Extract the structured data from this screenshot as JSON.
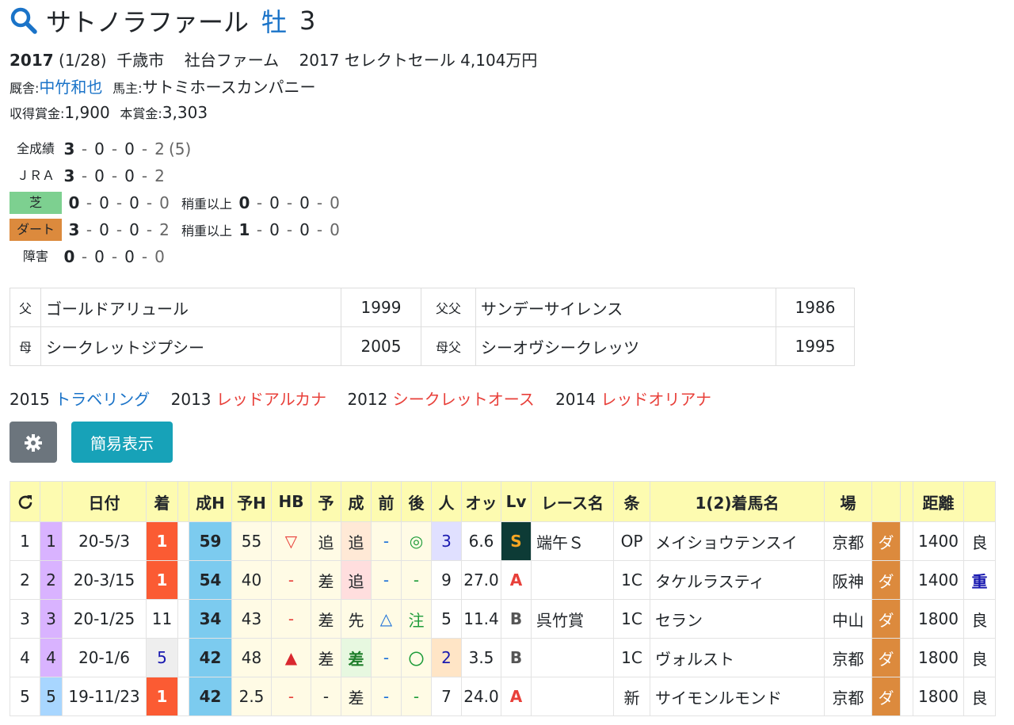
{
  "horse": {
    "name": "サトノラファール",
    "sex": "牡",
    "age": "3",
    "birth_year": "2017",
    "birth_date": "(1/28)",
    "birthplace": "千歳市",
    "breeder": "社台ファーム",
    "sale": "2017 セレクトセール 4,104万円",
    "stable_label": "厩舎:",
    "trainer": "中竹和也",
    "owner_label": "馬主:",
    "owner": "サトミホースカンパニー",
    "earned_label": "収得賞金:",
    "earned": "1,900",
    "prize_label": "本賞金:",
    "prize": "3,303"
  },
  "records": {
    "total": {
      "label": "全成績",
      "w": "3",
      "s": "0",
      "t": "0",
      "o": "2",
      "extra": "(5)"
    },
    "jra": {
      "label": "ＪＲＡ",
      "w": "3",
      "s": "0",
      "t": "0",
      "o": "2"
    },
    "turf": {
      "label": "芝",
      "w": "0",
      "s": "0",
      "t": "0",
      "o": "0",
      "heavy_label": "稍重以上",
      "hw": "0",
      "hs": "0",
      "ht": "0",
      "ho": "0"
    },
    "dirt": {
      "label": "ダート",
      "w": "3",
      "s": "0",
      "t": "0",
      "o": "2",
      "heavy_label": "稍重以上",
      "hw": "1",
      "hs": "0",
      "ht": "0",
      "ho": "0"
    },
    "obstacle": {
      "label": "障害",
      "w": "0",
      "s": "0",
      "t": "0",
      "o": "0"
    },
    "sep": "-"
  },
  "pedigree": {
    "sire_label": "父",
    "sire": "ゴールドアリュール",
    "sire_year": "1999",
    "sire_sire_label": "父父",
    "sire_sire": "サンデーサイレンス",
    "sire_sire_year": "1986",
    "dam_label": "母",
    "dam": "シークレットジプシー",
    "dam_year": "2005",
    "dam_sire_label": "母父",
    "dam_sire": "シーオヴシークレッツ",
    "dam_sire_year": "1995"
  },
  "siblings": [
    {
      "year": "2015",
      "name": "トラベリング",
      "color": "#1a73c8"
    },
    {
      "year": "2013",
      "name": "レッドアルカナ",
      "color": "#e8403a"
    },
    {
      "year": "2012",
      "name": "シークレットオース",
      "color": "#e8403a"
    },
    {
      "year": "2014",
      "name": "レッドオリアナ",
      "color": "#e8403a"
    }
  ],
  "buttons": {
    "gear_icon": "gear-icon",
    "simple_view": "簡易表示"
  },
  "table": {
    "headers": [
      "",
      "",
      "日付",
      "着",
      "",
      "成H",
      "予H",
      "HB",
      "予",
      "成",
      "前",
      "後",
      "人",
      "オッ",
      "Lv",
      "レース名",
      "条",
      "1(2)着馬名",
      "場",
      "",
      "",
      "距離",
      ""
    ],
    "rows": [
      {
        "idx": "1",
        "no": "1",
        "date": "20-5/3",
        "chaku": "1",
        "seiH": "59",
        "yoH": "55",
        "hb": "▽",
        "yo": "追",
        "sei": "追",
        "mae": "-",
        "ato": "◎",
        "ninki": "3",
        "odds": "6.6",
        "lv": "S",
        "race": "端午Ｓ",
        "cond": "OP",
        "horse": "メイショウテンスイ",
        "venue": "京都",
        "surface": "ダ",
        "dist": "1400",
        "going": "良"
      },
      {
        "idx": "2",
        "no": "2",
        "date": "20-3/15",
        "chaku": "1",
        "seiH": "54",
        "yoH": "40",
        "hb": "-",
        "yo": "差",
        "sei": "追",
        "mae": "-",
        "ato": "-",
        "ninki": "9",
        "odds": "27.0",
        "lv": "A",
        "race": "",
        "cond": "1C",
        "horse": "タケルラスティ",
        "venue": "阪神",
        "surface": "ダ",
        "dist": "1400",
        "going": "重"
      },
      {
        "idx": "3",
        "no": "3",
        "date": "20-1/25",
        "chaku": "11",
        "seiH": "34",
        "yoH": "43",
        "hb": "-",
        "yo": "差",
        "sei": "先",
        "mae": "△",
        "ato": "注",
        "ninki": "5",
        "odds": "11.4",
        "lv": "B",
        "race": "呉竹賞",
        "cond": "1C",
        "horse": "セラン",
        "venue": "中山",
        "surface": "ダ",
        "dist": "1800",
        "going": "良"
      },
      {
        "idx": "4",
        "no": "4",
        "date": "20-1/6",
        "chaku": "5",
        "seiH": "42",
        "yoH": "48",
        "hb": "▲",
        "yo": "差",
        "sei": "差",
        "mae": "-",
        "ato": "〇",
        "ninki": "2",
        "odds": "3.5",
        "lv": "B",
        "race": "",
        "cond": "1C",
        "horse": "ヴォルスト",
        "venue": "京都",
        "surface": "ダ",
        "dist": "1800",
        "going": "良"
      },
      {
        "idx": "5",
        "no": "5",
        "date": "19-11/23",
        "chaku": "1",
        "seiH": "42",
        "yoH": "2.5",
        "hb": "-",
        "yo": "-",
        "sei": "差",
        "mae": "-",
        "ato": "-",
        "ninki": "7",
        "odds": "24.0",
        "lv": "A",
        "race": "",
        "cond": "新",
        "horse": "サイモンルモンド",
        "venue": "京都",
        "surface": "ダ",
        "dist": "1800",
        "going": "良"
      }
    ]
  }
}
